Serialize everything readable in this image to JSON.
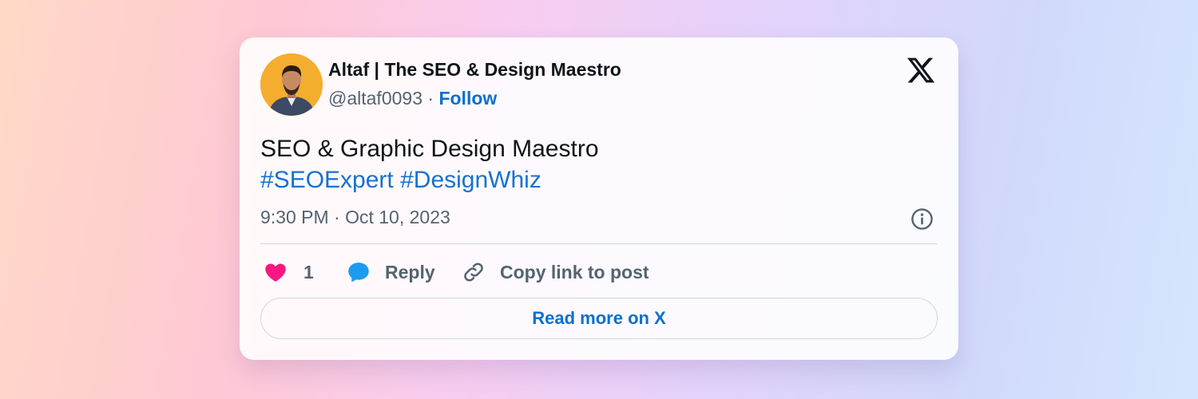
{
  "author": {
    "name": "Altaf | The SEO & Design Maestro",
    "handle": "@altaf0093",
    "separator": " · ",
    "follow_label": "Follow"
  },
  "tweet": {
    "text_line": "SEO & Graphic Design Maestro",
    "hashtags": [
      "#SEOExpert",
      "#DesignWhiz"
    ],
    "timestamp": "9:30 PM · Oct 10, 2023"
  },
  "actions": {
    "like_count": "1",
    "reply_label": "Reply",
    "copy_link_label": "Copy link to post"
  },
  "read_more_label": "Read more on X",
  "icons": {
    "platform": "x-logo-icon",
    "info": "info-icon",
    "like": "heart-icon",
    "reply": "speech-bubble-icon",
    "copy": "link-icon"
  },
  "colors": {
    "link_blue": "#0a6fd0",
    "hashtag_blue": "#1572d2",
    "like_pink": "#f91880",
    "reply_blue": "#1d9bf0",
    "avatar_bg": "#f4ad2e"
  }
}
